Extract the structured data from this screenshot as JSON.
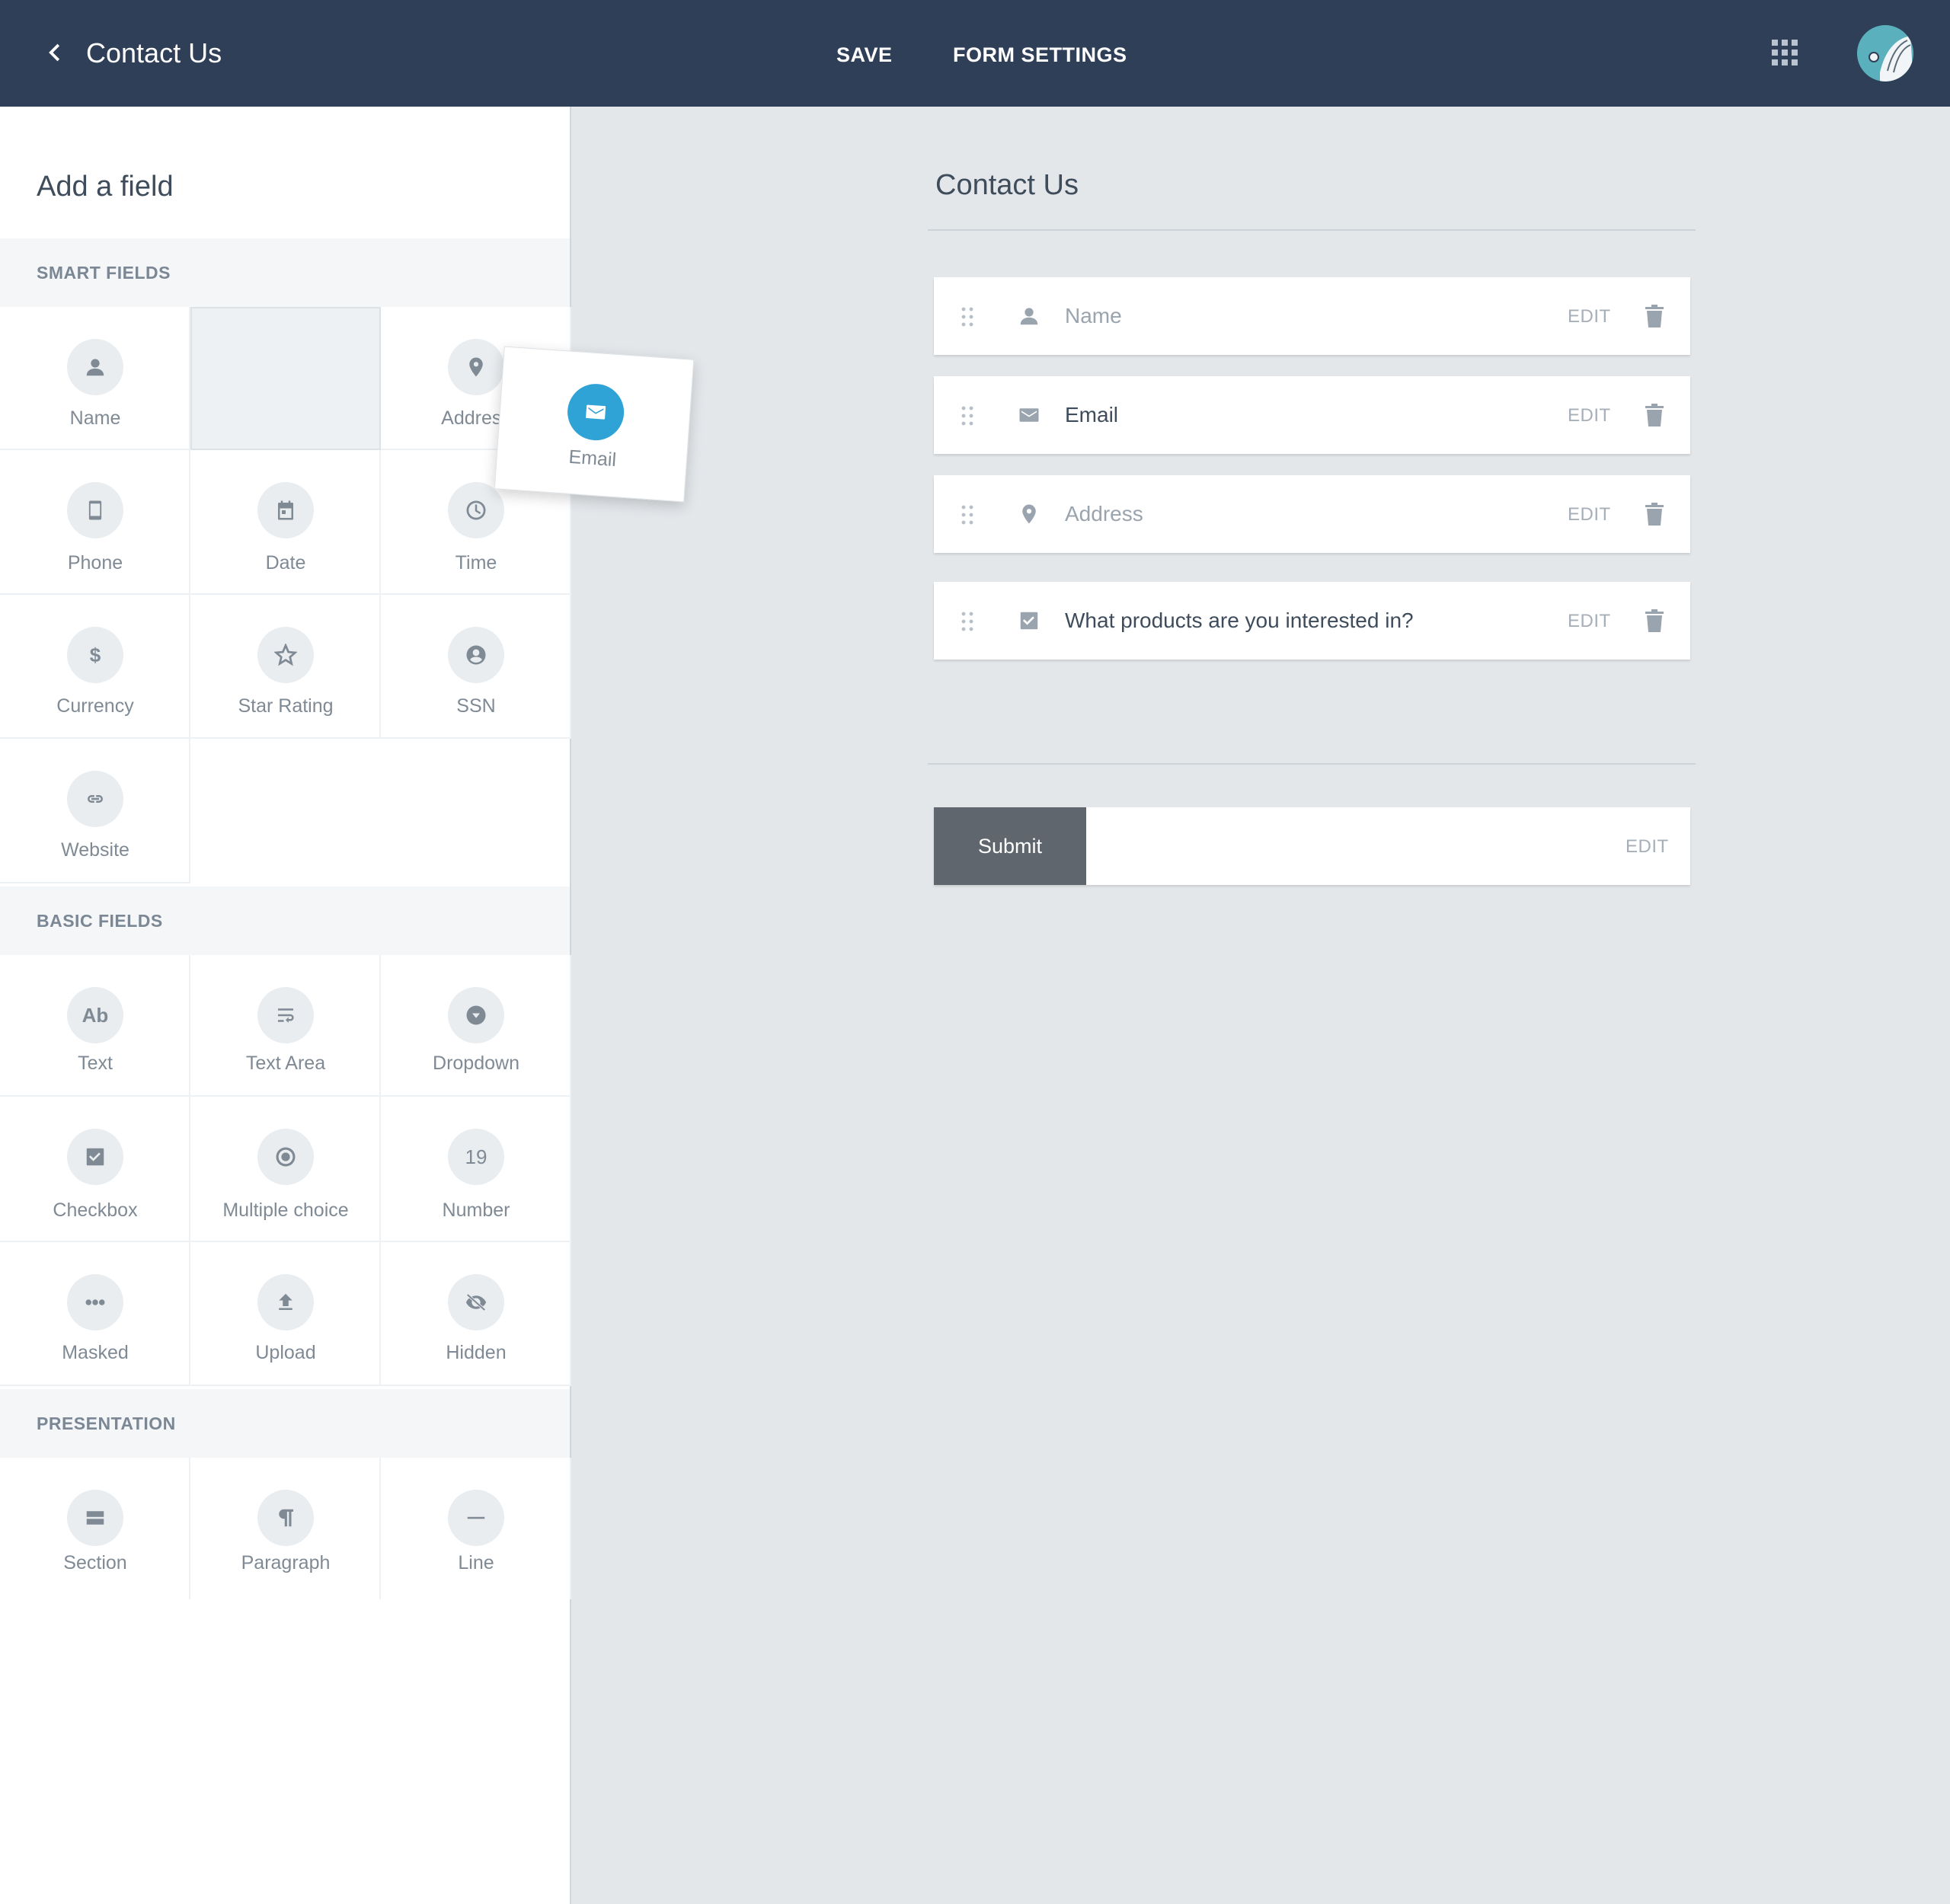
{
  "header": {
    "title": "Contact Us",
    "save_label": "SAVE",
    "form_settings_label": "FORM SETTINGS"
  },
  "sidebar": {
    "title": "Add a field",
    "smart_fields": {
      "label": "SMART FIELDS",
      "items": [
        {
          "label": "Name",
          "icon": "person-icon"
        },
        {
          "label": "Address",
          "icon": "location-pin-icon"
        },
        {
          "label": "Phone",
          "icon": "phone-icon"
        },
        {
          "label": "Date",
          "icon": "calendar-icon"
        },
        {
          "label": "Time",
          "icon": "clock-icon"
        },
        {
          "label": "Currency",
          "icon": "dollar-icon"
        },
        {
          "label": "Star Rating",
          "icon": "star-icon"
        },
        {
          "label": "SSN",
          "icon": "account-circle-icon"
        },
        {
          "label": "Website",
          "icon": "link-icon"
        }
      ]
    },
    "basic_fields": {
      "label": "BASIC FIELDS",
      "items": [
        {
          "label": "Text",
          "icon": "text-icon",
          "glyph": "Ab"
        },
        {
          "label": "Text Area",
          "icon": "text-wrap-icon"
        },
        {
          "label": "Dropdown",
          "icon": "dropdown-icon"
        },
        {
          "label": "Checkbox",
          "icon": "checkbox-icon"
        },
        {
          "label": "Multiple choice",
          "icon": "radio-icon"
        },
        {
          "label": "Number",
          "icon": "number-icon",
          "glyph": "19"
        },
        {
          "label": "Masked",
          "icon": "dots-icon"
        },
        {
          "label": "Upload",
          "icon": "upload-icon"
        },
        {
          "label": "Hidden",
          "icon": "eye-off-icon"
        }
      ]
    },
    "presentation": {
      "label": "PRESENTATION",
      "items": [
        {
          "label": "Section",
          "icon": "section-icon"
        },
        {
          "label": "Paragraph",
          "icon": "pilcrow-icon"
        },
        {
          "label": "Line",
          "icon": "line-icon"
        }
      ]
    }
  },
  "drag_preview": {
    "label": "Email",
    "icon": "mail-icon",
    "color": "#2fa3d6"
  },
  "form": {
    "title": "Contact Us",
    "fields": [
      {
        "label": "Name",
        "icon": "person-icon",
        "edit": "EDIT"
      },
      {
        "label": "Email",
        "icon": "mail-icon",
        "edit": "EDIT"
      },
      {
        "label": "Address",
        "icon": "location-pin-icon",
        "edit": "EDIT"
      },
      {
        "label": "What products are you interested in?",
        "icon": "checkbox-icon",
        "edit": "EDIT"
      }
    ],
    "submit_label": "Submit",
    "submit_edit": "EDIT"
  },
  "colors": {
    "topbar": "#2f3f58",
    "canvas": "#e3e7ea",
    "accent": "#2fa3d6",
    "submit": "#5f666d"
  }
}
